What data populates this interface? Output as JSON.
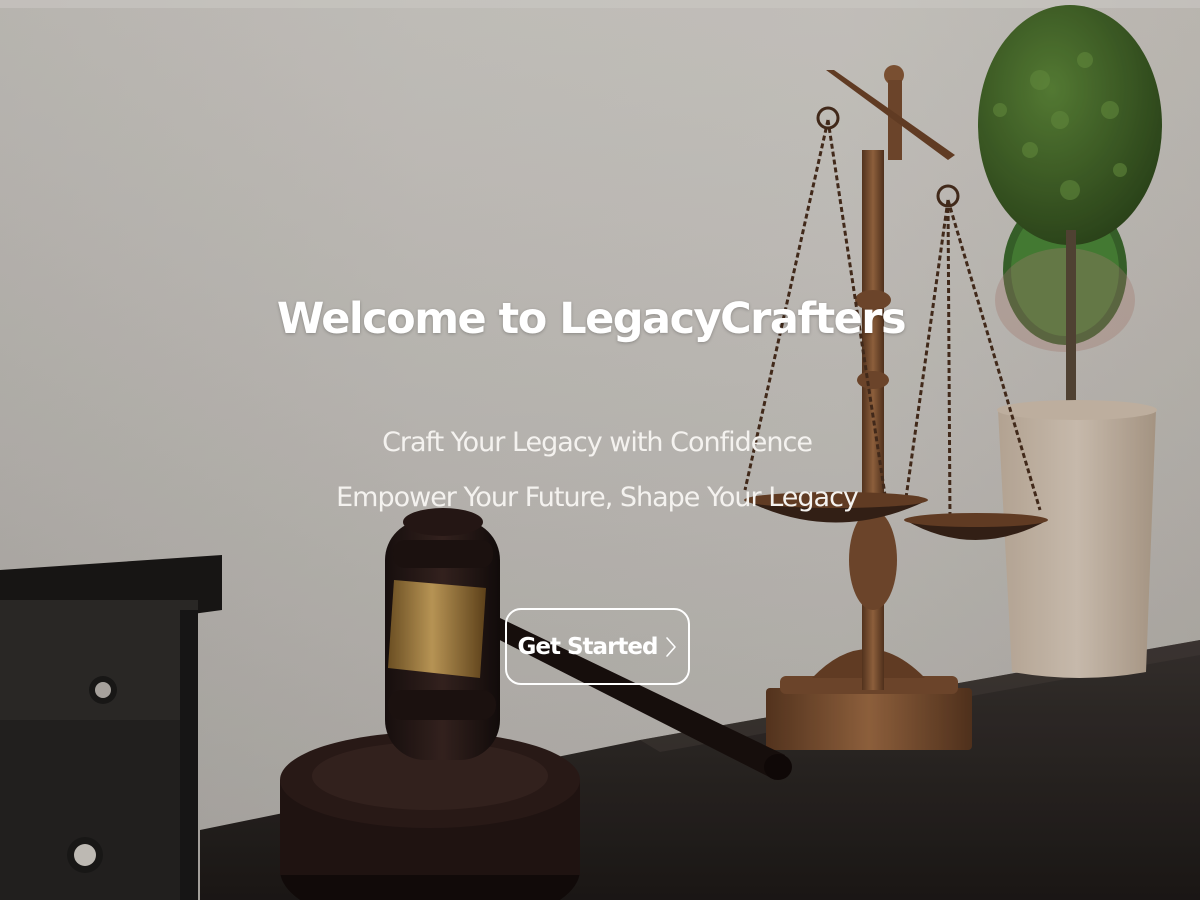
{
  "hero": {
    "title": "Welcome to LegacyCrafters",
    "tagline_1": "Craft Your Legacy with Confidence",
    "tagline_2": "Empower Your Future, Shape Your Legacy",
    "cta_label": "Get Started",
    "cta_icon": "chevron-right-icon"
  },
  "colors": {
    "text": "#ffffff",
    "cta_border": "#ffffff",
    "wall": "#d8d4cf",
    "desk": "#2a2522",
    "brass": "#8a5a38"
  }
}
